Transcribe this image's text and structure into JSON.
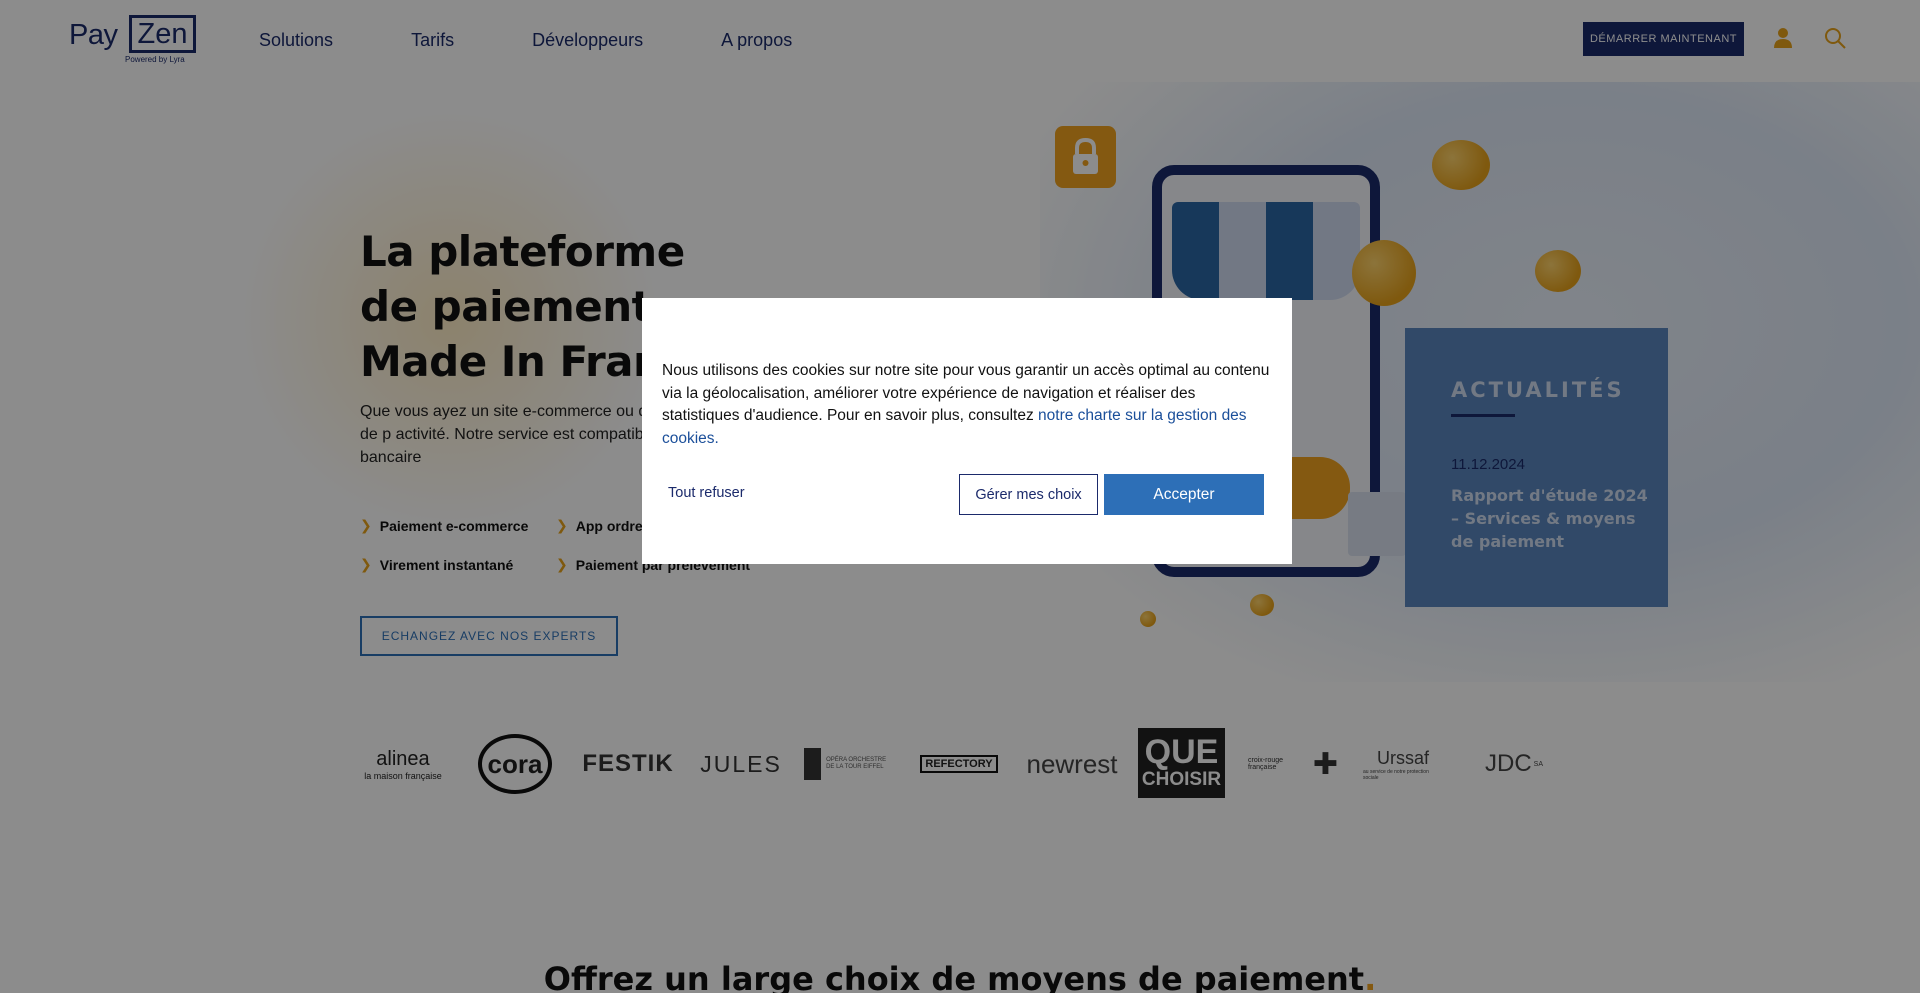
{
  "header": {
    "logo_pay": "Pay",
    "logo_zen": "Zen",
    "logo_sub": "Powered by Lyra",
    "nav": [
      "Solutions",
      "Tarifs",
      "Développeurs",
      "A propos"
    ],
    "cta": "DÉMARRER MAINTENANT",
    "user_icon": "user-icon",
    "search_icon": "search-icon"
  },
  "hero": {
    "title_lines": [
      "La plateforme",
      "de paiement",
      "Made In France"
    ],
    "description": "Que vous ayez un site e-commerce ou q paiements à distance, la plateforme de p activité. Notre service est compatible ave respect des derniers protocoles bancaire",
    "features": [
      "Paiement e-commerce",
      "App ordre",
      "Virement instantané",
      "Paiement par prélèvement"
    ],
    "cta": "ECHANGEZ AVEC NOS EXPERTS"
  },
  "news": {
    "title": "ACTUALITÉS",
    "date": "11.12.2024",
    "text": "Rapport d'étude 2024 – Services & moyens de paiement"
  },
  "clients": {
    "alinea": "alinea",
    "alinea_sub": "la maison française",
    "cora": "cora",
    "festik": "FESTIK",
    "jules": "JULES",
    "opera": "OPÉRA ORCHESTRE DE LA TOUR EIFFEL",
    "refectory": "REFECTORY",
    "newrest": "newrest",
    "quechoisir_1": "QUE",
    "quechoisir_2": "CHOISIR",
    "croixrouge": "croix-rouge française",
    "urssaf": "Urssaf",
    "urssaf_sub": "au service de notre protection sociale",
    "jdc": "JDC",
    "jdc_sub": "SA"
  },
  "section": {
    "title": "Offrez un large choix de moyens de paiement",
    "dot": "."
  },
  "cookie_modal": {
    "text": "Nous utilisons des cookies sur notre site pour vous garantir un accès optimal au contenu via la géolocalisation, améliorer votre expérience de navigation et réaliser des statistiques d'audience. Pour en savoir plus, consultez ",
    "link": "notre charte sur la gestion des cookies.",
    "refuse": "Tout refuser",
    "manage": "Gérer mes choix",
    "accept": "Accepter"
  },
  "colors": {
    "brand_navy": "#1b2a6b",
    "accent_blue": "#2d6fb7",
    "accent_orange": "#f0a31f",
    "news_bg": "#5a86bd"
  }
}
